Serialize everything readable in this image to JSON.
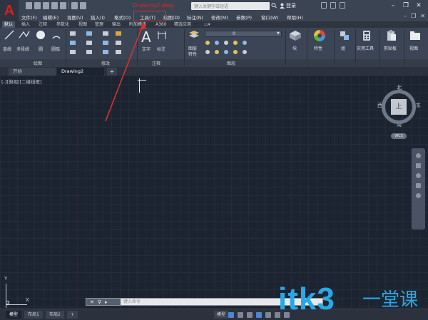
{
  "titlebar": {
    "doc_title": "Drawing2.dwg",
    "search_placeholder": "键入关键字或短语",
    "login_label": "登录"
  },
  "menu": {
    "items": [
      "文件(F)",
      "编辑(E)",
      "视图(V)",
      "插入(I)",
      "格式(O)",
      "工具(T)",
      "绘图(D)",
      "标注(N)",
      "修改(M)",
      "参数(P)",
      "窗口(W)",
      "帮助(H)"
    ]
  },
  "ribbon_tabs": [
    "默认",
    "插入",
    "注释",
    "参数化",
    "视图",
    "管理",
    "输出",
    "附加模块",
    "A360",
    "精选应用"
  ],
  "ribbon": {
    "draw": {
      "line": "直线",
      "polyline": "多段线",
      "circle": "圆",
      "arc": "圆弧",
      "panel": "绘图"
    },
    "modify": {
      "panel": "修改"
    },
    "annotation": {
      "text": "文字",
      "dimension": "标注",
      "panel": "注释"
    },
    "layers": {
      "properties_line1": "图层",
      "properties_line2": "特性",
      "combo_value": "0",
      "panel": "图层"
    },
    "block": {
      "label": "块"
    },
    "properties": {
      "label": "特性"
    },
    "group": {
      "label": "组"
    },
    "utilities": {
      "label": "实用工具"
    },
    "clipboard": {
      "label": "剪贴板"
    },
    "view": {
      "label": "视图"
    }
  },
  "doc_tabs": {
    "start": "开始",
    "current": "Drawing2"
  },
  "viewport_label": "[-][俯视][二维线框]",
  "viewcube": {
    "north": "北",
    "south": "南",
    "east": "东",
    "west": "西",
    "face": "上",
    "wcs": "WCS"
  },
  "ucs": {
    "x": "X",
    "y": "Y"
  },
  "command_line": {
    "placeholder": "键入命令"
  },
  "statusbar": {
    "tabs": [
      "模型",
      "布局1",
      "布局2"
    ],
    "model_label": "模型"
  },
  "watermark": {
    "text": "itk3",
    "suffix": "一堂课"
  },
  "colors": {
    "accent_red": "#d8322c",
    "logo_red": "#d71f1f",
    "watermark_blue": "#29a8e6"
  }
}
